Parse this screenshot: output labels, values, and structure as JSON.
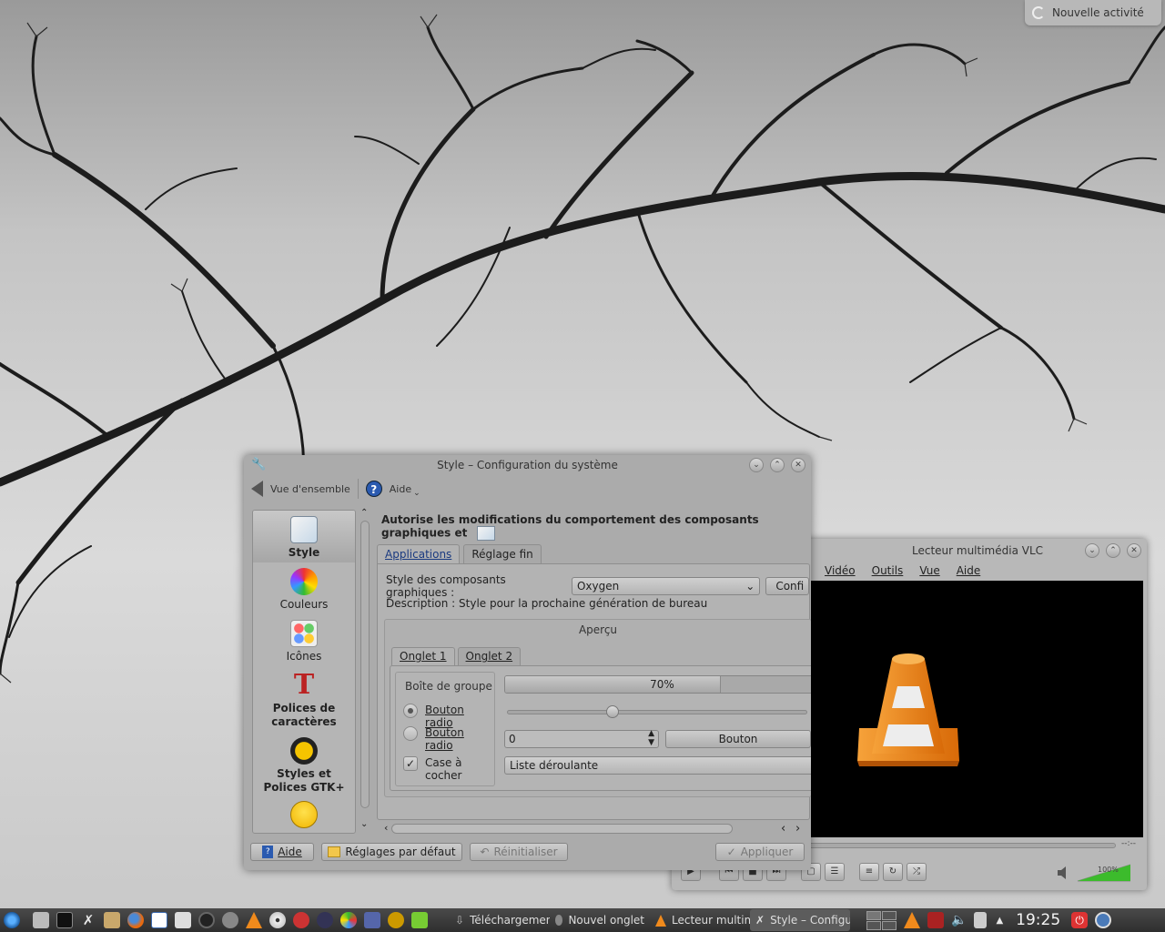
{
  "desktop": {
    "activity_label": "Nouvelle activité"
  },
  "vlc": {
    "title": "Lecteur multimédia VLC",
    "menu": [
      "Vidéo",
      "Outils",
      "Vue",
      "Aide"
    ],
    "time": "--:--",
    "volume_percent": "100%",
    "volume_level": 1.0
  },
  "settings": {
    "title": "Style – Configuration du système",
    "toolbar": {
      "overview": "Vue d'ensemble",
      "help": "Aide"
    },
    "sidebar": [
      {
        "label": "Style",
        "icon": "style-icon",
        "active": true
      },
      {
        "label": "Couleurs",
        "icon": "colors-icon"
      },
      {
        "label": "Icônes",
        "icon": "icons-icon"
      },
      {
        "label": "Polices de caractères",
        "icon": "fonts-icon"
      },
      {
        "label": "Styles et Polices GTK+",
        "icon": "gtk-icon"
      },
      {
        "label": "",
        "icon": "emoticons-icon"
      }
    ],
    "heading": "Autorise les modifications du comportement des composants graphiques et",
    "tabs": [
      "Applications",
      "Réglage fin"
    ],
    "widget_style_label": "Style des composants graphiques :",
    "widget_style_value": "Oxygen",
    "configure_button": "Confi",
    "description": "Description : Style pour la prochaine génération de bureau",
    "preview": {
      "title": "Aperçu",
      "tabs": [
        "Onglet 1",
        "Onglet 2"
      ],
      "group_title": "Boîte de groupe",
      "radio1": "Bouton radio",
      "radio2": "Bouton radio",
      "checkbox": "Case à cocher",
      "progress_text": "70%",
      "progress_value": 0.7,
      "slider_value": 0.33,
      "spin_value": "0",
      "button": "Bouton",
      "dropdown": "Liste déroulante"
    },
    "buttons": {
      "help": "Aide",
      "defaults": "Réglages par défaut",
      "reset": "Réinitialiser",
      "apply": "Appliquer"
    }
  },
  "taskbar": {
    "tasks": [
      {
        "label": "Téléchargemen",
        "icon": "download-icon"
      },
      {
        "label": "Nouvel onglet",
        "icon": "browser-icon"
      },
      {
        "label": "Lecteur multim",
        "icon": "vlc-icon"
      },
      {
        "label": "Style – Configu",
        "icon": "settings-icon",
        "active": true
      }
    ],
    "clock": "19:25"
  },
  "colors": {
    "vlc_orange": "#f08a1c",
    "taskbar": "#3a3a3a",
    "help_blue": "#2a5ab0"
  }
}
